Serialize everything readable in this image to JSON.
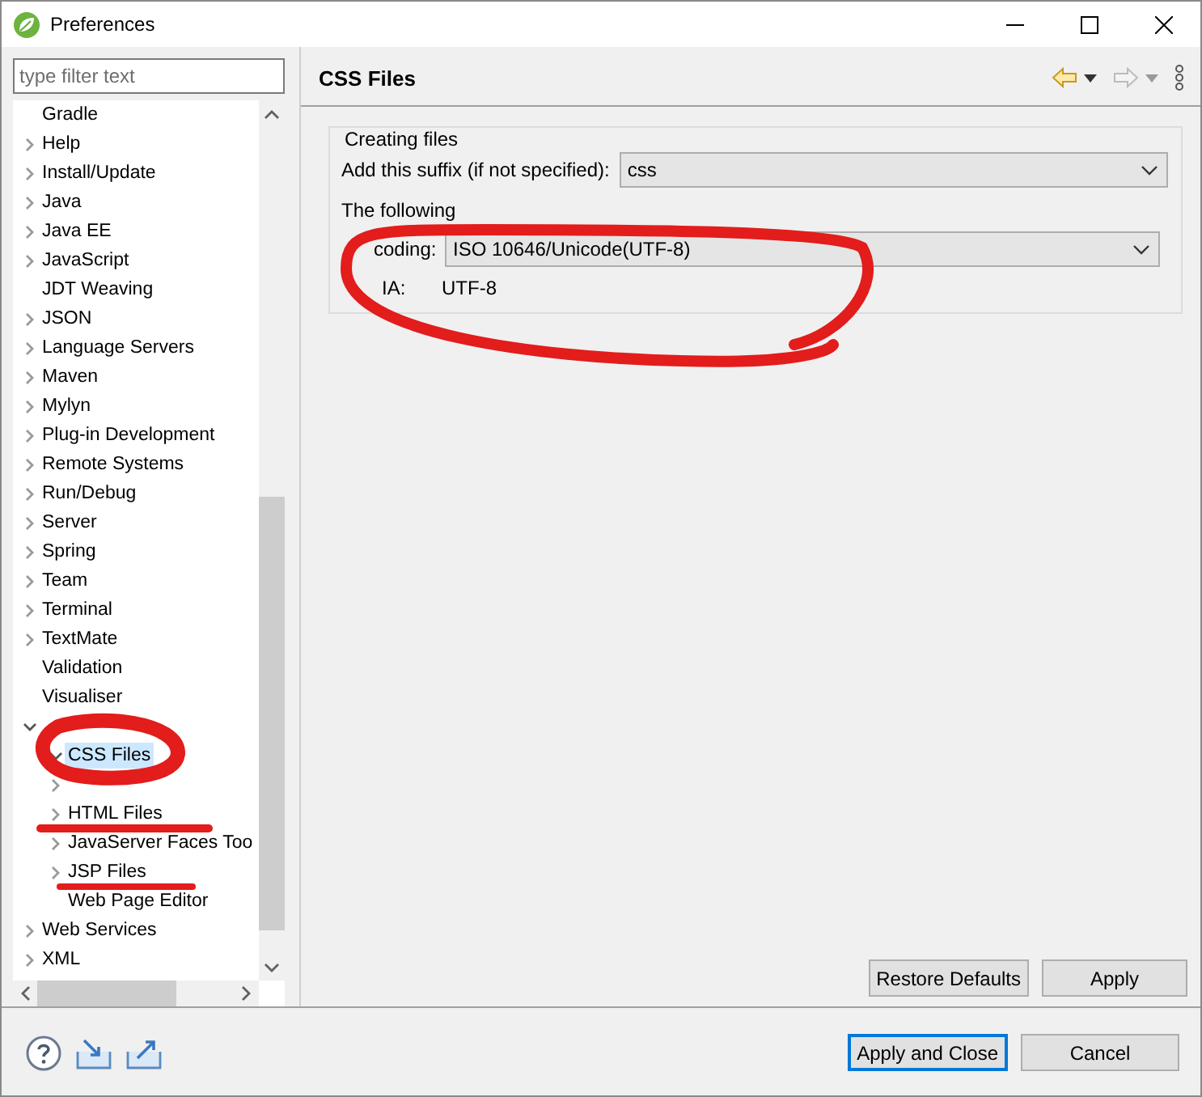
{
  "window": {
    "title": "Preferences"
  },
  "filter": {
    "placeholder": "type filter text"
  },
  "tree": [
    {
      "label": "Gradle",
      "expandable": false,
      "selected": false
    },
    {
      "label": "Help",
      "expandable": true,
      "expanded": false,
      "selected": false
    },
    {
      "label": "Install/Update",
      "expandable": true,
      "expanded": false,
      "selected": false
    },
    {
      "label": "Java",
      "expandable": true,
      "expanded": false,
      "selected": false
    },
    {
      "label": "Java EE",
      "expandable": true,
      "expanded": false,
      "selected": false
    },
    {
      "label": "JavaScript",
      "expandable": true,
      "expanded": false,
      "selected": false
    },
    {
      "label": "JDT Weaving",
      "expandable": false,
      "selected": false
    },
    {
      "label": "JSON",
      "expandable": true,
      "expanded": false,
      "selected": false
    },
    {
      "label": "Language Servers",
      "expandable": true,
      "expanded": false,
      "selected": false
    },
    {
      "label": "Maven",
      "expandable": true,
      "expanded": false,
      "selected": false
    },
    {
      "label": "Mylyn",
      "expandable": true,
      "expanded": false,
      "selected": false
    },
    {
      "label": "Plug-in Development",
      "expandable": true,
      "expanded": false,
      "selected": false
    },
    {
      "label": "Remote Systems",
      "expandable": true,
      "expanded": false,
      "selected": false
    },
    {
      "label": "Run/Debug",
      "expandable": true,
      "expanded": false,
      "selected": false
    },
    {
      "label": "Server",
      "expandable": true,
      "expanded": false,
      "selected": false
    },
    {
      "label": "Spring",
      "expandable": true,
      "expanded": false,
      "selected": false
    },
    {
      "label": "Team",
      "expandable": true,
      "expanded": false,
      "selected": false
    },
    {
      "label": "Terminal",
      "expandable": true,
      "expanded": false,
      "selected": false
    },
    {
      "label": "TextMate",
      "expandable": true,
      "expanded": false,
      "selected": false
    },
    {
      "label": "Validation",
      "expandable": false,
      "selected": false
    },
    {
      "label": "Visualiser",
      "expandable": false,
      "selected": false
    },
    {
      "expandable": true,
      "expanded": true,
      "children": [
        {
          "label": "CSS Files",
          "expandable": true,
          "expanded": true,
          "selected": true
        },
        {
          "expandable": true,
          "expanded": false
        },
        {
          "label": "HTML Files",
          "expandable": true,
          "expanded": false,
          "selected": false
        },
        {
          "label": "JavaServer Faces Too",
          "expandable": true,
          "expanded": false,
          "selected": false
        },
        {
          "label": "JSP Files",
          "expandable": true,
          "expanded": false,
          "selected": false
        },
        {
          "label": "Web Page Editor",
          "expandable": false,
          "selected": false
        }
      ]
    },
    {
      "label": "Web Services",
      "expandable": true,
      "expanded": false,
      "selected": false
    },
    {
      "label": "XML",
      "expandable": true,
      "expanded": false,
      "selected": false
    }
  ],
  "page": {
    "title": "CSS Files",
    "group": {
      "title": "Creating files",
      "suffix_label": "Add this suffix (if not specified):",
      "suffix_value": "css",
      "note": "The following",
      "encoding_label": "coding:",
      "encoding_value": "ISO 10646/Unicode(UTF-8)",
      "iana_label": "IA:",
      "iana_value": "UTF-8"
    },
    "buttons": [
      "Restore Defaults",
      "Apply"
    ]
  },
  "footer": {
    "buttons": [
      {
        "label": "Apply and Close",
        "default": true
      },
      {
        "label": "Cancel",
        "default": false
      }
    ]
  }
}
